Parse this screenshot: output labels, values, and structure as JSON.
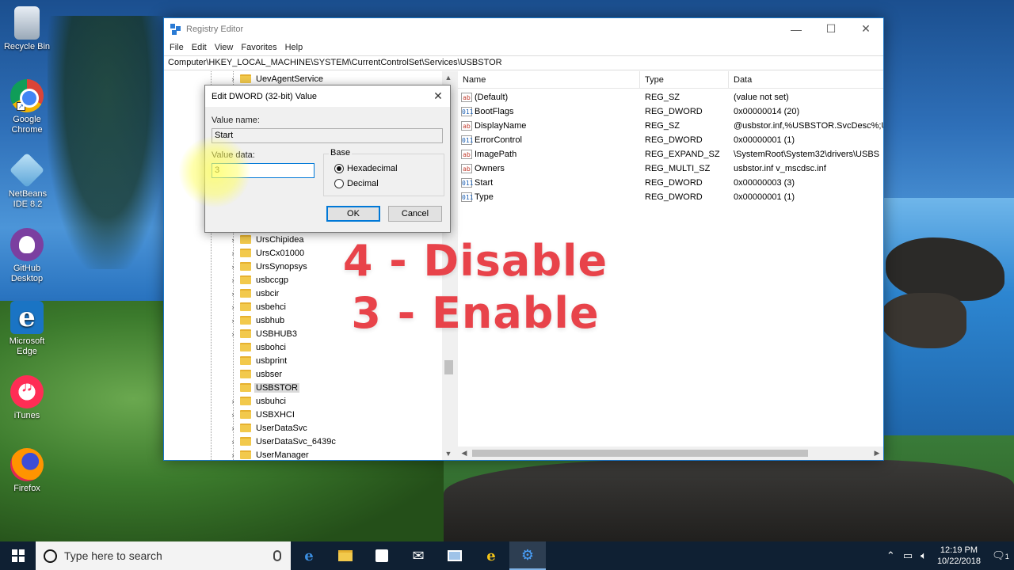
{
  "desktop": {
    "icons": [
      {
        "label": "Recycle Bin",
        "icon": "recycle-bin-icon"
      },
      {
        "label": "Google Chrome",
        "icon": "chrome-icon"
      },
      {
        "label": "NetBeans IDE 8.2",
        "icon": "netbeans-icon"
      },
      {
        "label": "GitHub Desktop",
        "icon": "github-desktop-icon"
      },
      {
        "label": "Microsoft Edge",
        "icon": "edge-icon"
      },
      {
        "label": "iTunes",
        "icon": "itunes-icon"
      },
      {
        "label": "Firefox",
        "icon": "firefox-icon"
      }
    ]
  },
  "window": {
    "title": "Registry Editor",
    "controls": {
      "minimize": "—",
      "maximize": "☐",
      "close": "✕"
    },
    "menu": [
      "File",
      "Edit",
      "View",
      "Favorites",
      "Help"
    ],
    "address": "Computer\\HKEY_LOCAL_MACHINE\\SYSTEM\\CurrentControlSet\\Services\\USBSTOR"
  },
  "tree": {
    "items": [
      {
        "label": "UevAgentService",
        "expander": "›"
      },
      {
        "label": "UrsChipidea",
        "expander": "›"
      },
      {
        "label": "UrsCx01000",
        "expander": "›"
      },
      {
        "label": "UrsSynopsys",
        "expander": "›"
      },
      {
        "label": "usbccgp",
        "expander": "›"
      },
      {
        "label": "usbcir",
        "expander": "›"
      },
      {
        "label": "usbehci",
        "expander": "›"
      },
      {
        "label": "usbhub",
        "expander": "›"
      },
      {
        "label": "USBHUB3",
        "expander": "›"
      },
      {
        "label": "usbohci",
        "expander": ""
      },
      {
        "label": "usbprint",
        "expander": ""
      },
      {
        "label": "usbser",
        "expander": ""
      },
      {
        "label": "USBSTOR",
        "expander": "",
        "selected": true
      },
      {
        "label": "usbuhci",
        "expander": "›"
      },
      {
        "label": "USBXHCI",
        "expander": "›"
      },
      {
        "label": "UserDataSvc",
        "expander": "›"
      },
      {
        "label": "UserDataSvc_6439c",
        "expander": "›"
      },
      {
        "label": "UserManager",
        "expander": "›"
      }
    ]
  },
  "values": {
    "headers": {
      "name": "Name",
      "type": "Type",
      "data": "Data"
    },
    "rows": [
      {
        "icon": "ab",
        "name": "(Default)",
        "type": "REG_SZ",
        "data": "(value not set)"
      },
      {
        "icon": "011",
        "name": "BootFlags",
        "type": "REG_DWORD",
        "data": "0x00000014 (20)"
      },
      {
        "icon": "ab",
        "name": "DisplayName",
        "type": "REG_SZ",
        "data": "@usbstor.inf,%USBSTOR.SvcDesc%;U"
      },
      {
        "icon": "011",
        "name": "ErrorControl",
        "type": "REG_DWORD",
        "data": "0x00000001 (1)"
      },
      {
        "icon": "ab",
        "name": "ImagePath",
        "type": "REG_EXPAND_SZ",
        "data": "\\SystemRoot\\System32\\drivers\\USBS"
      },
      {
        "icon": "ab",
        "name": "Owners",
        "type": "REG_MULTI_SZ",
        "data": "usbstor.inf v_mscdsc.inf"
      },
      {
        "icon": "011",
        "name": "Start",
        "type": "REG_DWORD",
        "data": "0x00000003 (3)"
      },
      {
        "icon": "011",
        "name": "Type",
        "type": "REG_DWORD",
        "data": "0x00000001 (1)"
      }
    ]
  },
  "overlay": {
    "line1": "4 - Disable",
    "line2": "3 - Enable"
  },
  "dialog": {
    "title": "Edit DWORD (32-bit) Value",
    "close": "✕",
    "value_name_label": "Value name:",
    "value_name": "Start",
    "value_data_label": "Value data:",
    "value_data": "3",
    "base_label": "Base",
    "hex_label": "Hexadecimal",
    "hex_selected": true,
    "dec_label": "Decimal",
    "ok": "OK",
    "cancel": "Cancel"
  },
  "taskbar": {
    "search_placeholder": "Type here to search",
    "apps": [
      "edge-icon",
      "file-explorer-icon",
      "store-icon",
      "mail-icon",
      "network-icon",
      "ie-icon",
      "regedit-icon"
    ],
    "time": "12:19 PM",
    "date": "10/22/2018",
    "notifications": "1"
  }
}
